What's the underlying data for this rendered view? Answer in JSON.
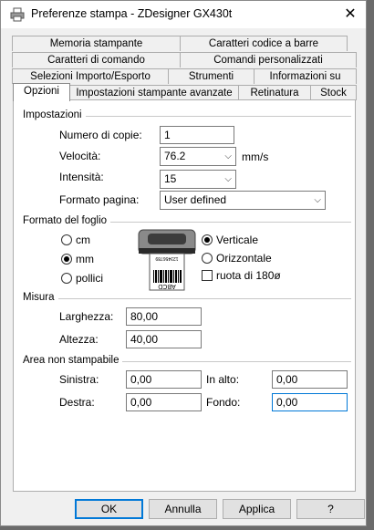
{
  "window": {
    "title": "Preferenze stampa - ZDesigner GX430t",
    "close_symbol": "✕"
  },
  "tabs": {
    "row1": [
      "Memoria stampante",
      "Caratteri codice a barre"
    ],
    "row2": [
      "Caratteri di comando",
      "Comandi personalizzati"
    ],
    "row3": [
      "Selezioni Importo/Esporto",
      "Strumenti",
      "Informazioni su"
    ],
    "row4": [
      "Opzioni",
      "Impostazioni stampante avanzate",
      "Retinatura",
      "Stock"
    ],
    "active": "Opzioni"
  },
  "impostazioni": {
    "title": "Impostazioni",
    "copies_label": "Numero di copie:",
    "copies_value": "1",
    "speed_label": "Velocità:",
    "speed_value": "76.2",
    "speed_unit": "mm/s",
    "intensity_label": "Intensità:",
    "intensity_value": "15",
    "page_format_label": "Formato pagina:",
    "page_format_value": "User defined"
  },
  "formato_foglio": {
    "title": "Formato del foglio",
    "unit_options": [
      "cm",
      "mm",
      "pollici"
    ],
    "selected_unit": "mm",
    "orientation_options": [
      "Verticale",
      "Orizzontale"
    ],
    "selected_orientation": "Verticale",
    "rotate_label": "ruota di 180ø",
    "rotate_checked": false,
    "label_text": "ABCD",
    "label_small_text": "123456789"
  },
  "misura": {
    "title": "Misura",
    "width_label": "Larghezza:",
    "width_value": "80,00",
    "height_label": "Altezza:",
    "height_value": "40,00"
  },
  "area_non_stampabile": {
    "title": "Area non stampabile",
    "left_label": "Sinistra:",
    "left_value": "0,00",
    "top_label": "In alto:",
    "top_value": "0,00",
    "right_label": "Destra:",
    "right_value": "0,00",
    "bottom_label": "Fondo:",
    "bottom_value": "0,00"
  },
  "buttons": {
    "ok": "OK",
    "cancel": "Annulla",
    "apply": "Applica",
    "help": "?"
  }
}
